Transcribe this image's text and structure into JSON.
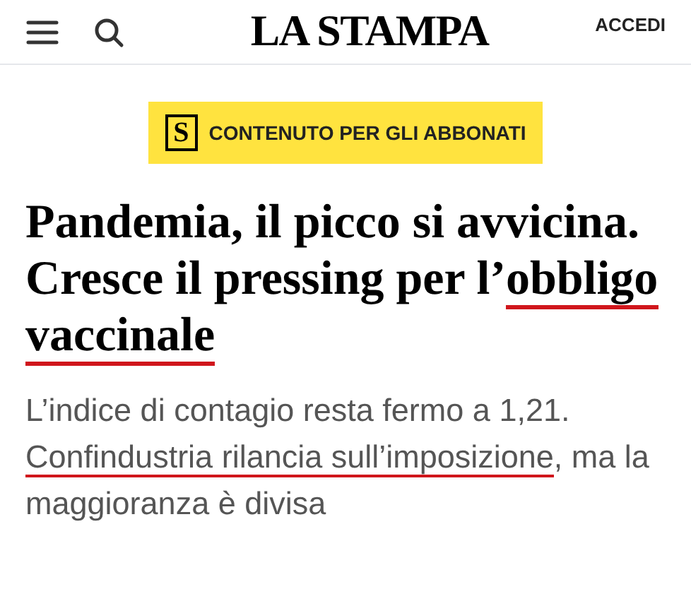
{
  "header": {
    "logo": "LA STAMPA",
    "login": "ACCEDI"
  },
  "badge": {
    "icon_letter": "S",
    "label": "CONTENUTO PER GLI ABBONATI"
  },
  "headline": [
    {
      "text": "Pandemia, il picco si avvicina. Cresce il pressing per l’",
      "underlined": false
    },
    {
      "text": "obbligo vaccinale",
      "underlined": true
    }
  ],
  "summary": [
    {
      "text": "L’indice di contagio resta fermo a 1,21. ",
      "underlined": false
    },
    {
      "text": "Confindustria rilancia sull’imposizione",
      "underlined": true
    },
    {
      "text": ", ma la maggioranza è divisa",
      "underlined": false
    }
  ]
}
